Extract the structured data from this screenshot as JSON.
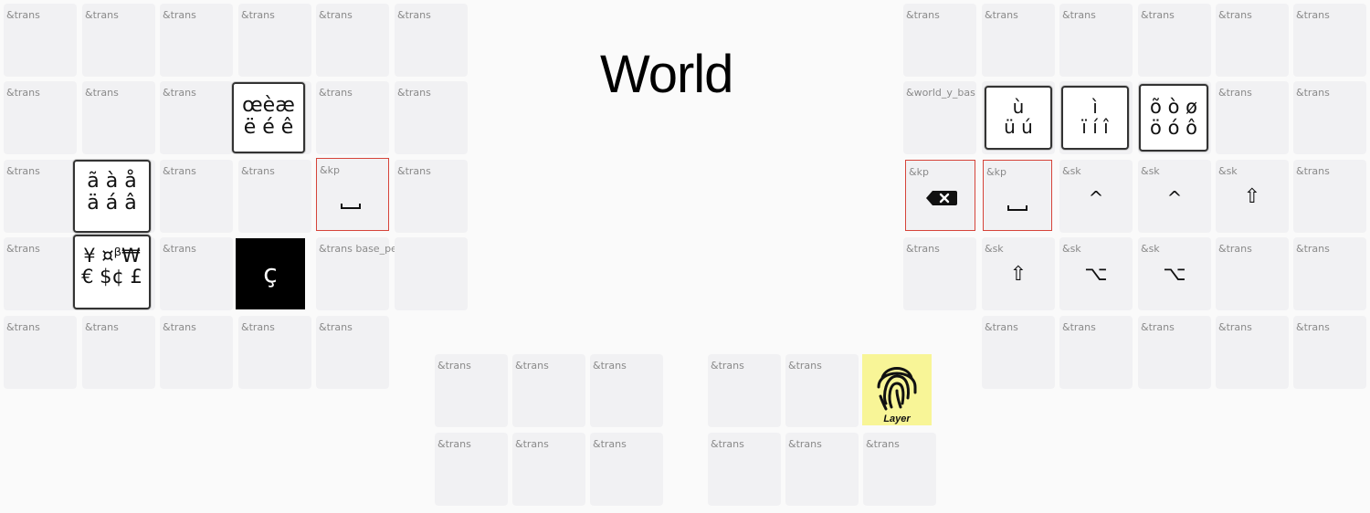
{
  "title": "World",
  "labels": {
    "trans": "&trans",
    "kp": "&kp",
    "sk": "&sk",
    "world_y": "&world_y_bas",
    "base_pe": "&trans base_pe&tran",
    "overlap_a": "&trans",
    "overlap_b": "&trans"
  },
  "symbols": {
    "c_cedilla": "ç",
    "caret": "^",
    "shift_icon": "⇧",
    "option_icon": "⌥",
    "layer": "Layer"
  },
  "glyph_cards": {
    "oe": [
      "œèæ",
      "ë é ê"
    ],
    "a": [
      "ã à å",
      "ä á â"
    ],
    "cur": [
      "¥ ¤ᵝ₩",
      "€ $¢ £"
    ],
    "u": [
      "ù",
      "ü ú"
    ],
    "i": [
      "ì",
      "ï í î"
    ],
    "o": [
      "õ ò ø",
      "ö ó ô"
    ]
  },
  "colors": {
    "key_bg": "#f1f1f3",
    "red_border": "#d6443a",
    "dark_key": "#000000",
    "yellow_key": "#f8f597"
  }
}
